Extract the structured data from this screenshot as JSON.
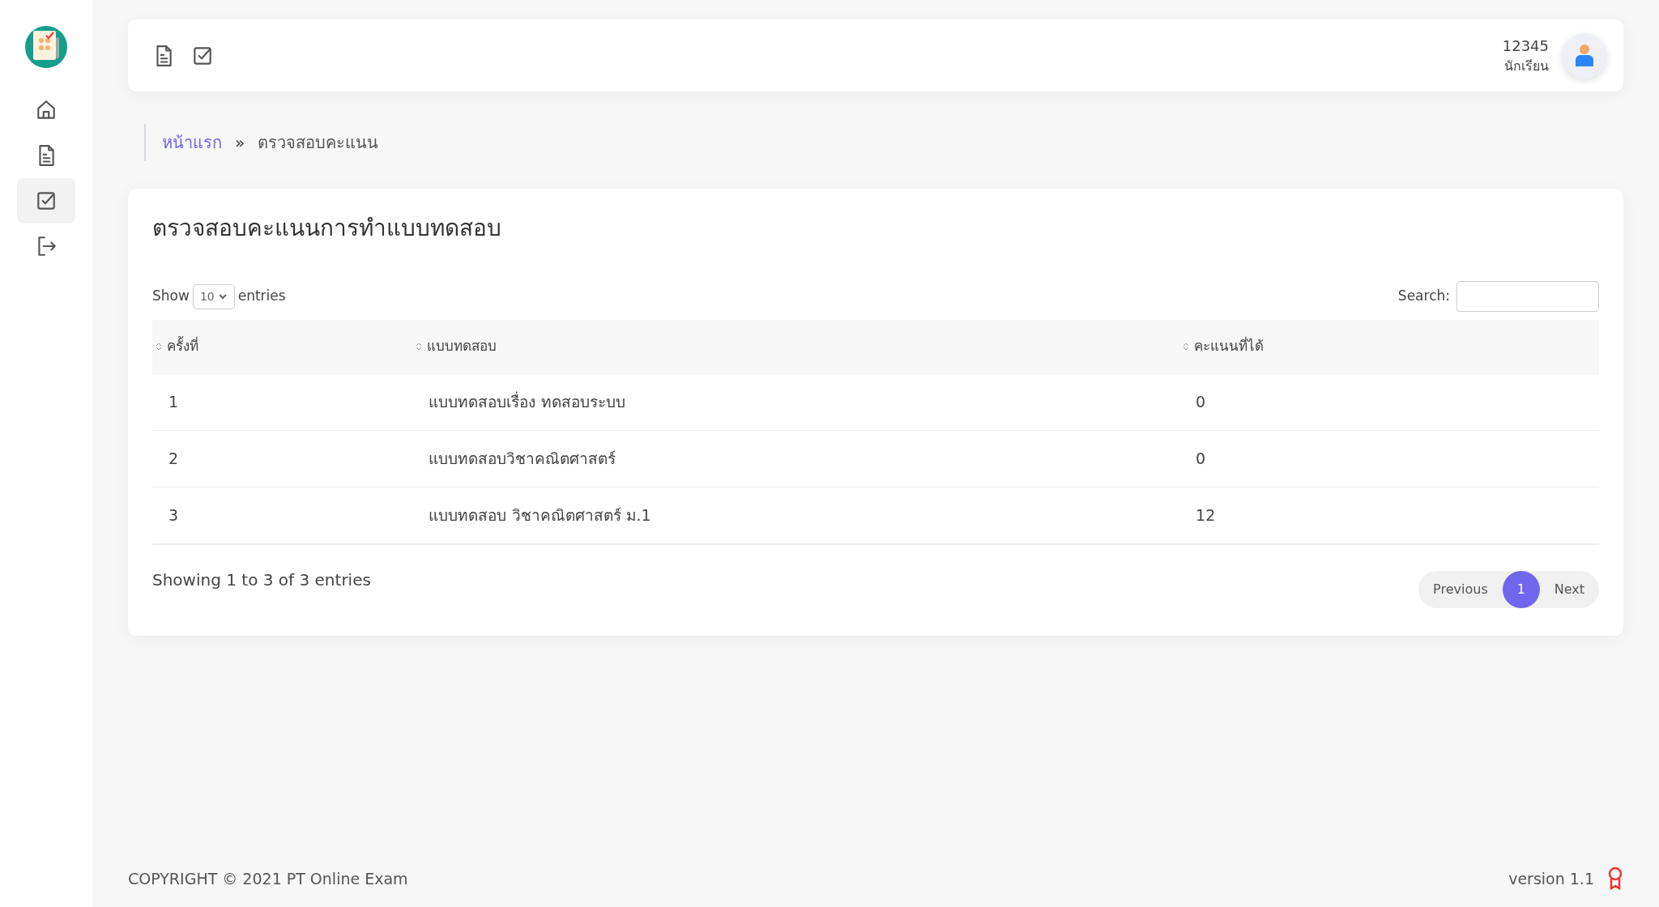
{
  "sidebar": {
    "items": [
      {
        "kind": "home",
        "selected": false
      },
      {
        "kind": "document",
        "selected": false
      },
      {
        "kind": "check",
        "selected": true
      },
      {
        "kind": "logout",
        "selected": false
      }
    ]
  },
  "topbar": {
    "icons": [
      {
        "kind": "document"
      },
      {
        "kind": "check"
      }
    ],
    "user": {
      "id": "12345",
      "role": "นักเรียน"
    }
  },
  "breadcrumb": [
    {
      "label": "หน้าแรก",
      "link": true
    },
    {
      "label": "ตรวจสอบคะแนน",
      "link": false
    }
  ],
  "breadcrumb_separator": "»",
  "card": {
    "title": "ตรวจสอบคะแนนการทำแบบทดสอบ",
    "length": {
      "before": "Show",
      "value": "10",
      "after": "entries"
    },
    "search": {
      "label": "Search:"
    },
    "table": {
      "columns": [
        "ครั้งที่",
        "แบบทดสอบ",
        "คะแนนที่ได้"
      ],
      "rows": [
        [
          "1",
          "แบบทดสอบเรื่อง ทดสอบระบบ",
          "0"
        ],
        [
          "2",
          "แบบทดสอบวิชาคณิตศาสตร์",
          "0"
        ],
        [
          "3",
          "แบบทดสอบ วิชาคณิตศาสตร์ ม.1",
          "12"
        ]
      ]
    },
    "info": "Showing 1 to 3 of 3 entries",
    "pagination": [
      {
        "label": "Previous",
        "selected": false
      },
      {
        "label": "1",
        "selected": true
      },
      {
        "label": "Next",
        "selected": false
      }
    ]
  },
  "footer": {
    "copyright": "COPYRIGHT © 2021 PT Online Exam",
    "version": "version 1.1"
  }
}
